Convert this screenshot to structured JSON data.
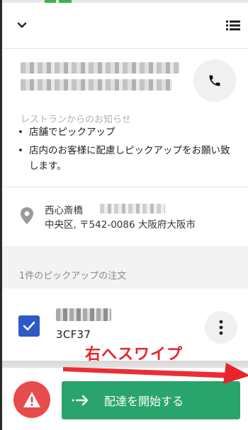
{
  "header": {
    "collapse_icon": "chevron-down-icon",
    "list_icon": "list-icon"
  },
  "restaurant": {
    "call_icon": "phone-icon"
  },
  "notice": {
    "title": "レストランからのお知らせ",
    "items": [
      "店舗でピックアップ",
      "店内のお客様に配慮しピックアップをお願い致します。"
    ]
  },
  "address": {
    "line1": "西心斎橋",
    "line2": "中央区, 〒542-0086 大阪府大阪市",
    "icon": "map-pin-icon"
  },
  "orders": {
    "title": "1件のピックアップの注文",
    "items": [
      {
        "code": "3CF37",
        "checked": true
      }
    ]
  },
  "actions": {
    "start_label": "配達を開始する",
    "alert_icon": "warning-icon",
    "start_icon": "arrow-right-icon"
  },
  "annotation": {
    "text": "右へスワイプ",
    "color": "#e8232a"
  },
  "colors": {
    "accent_green": "#2aa46d",
    "checkbox_blue": "#2e59c6",
    "alert_red": "#e84b4b"
  }
}
